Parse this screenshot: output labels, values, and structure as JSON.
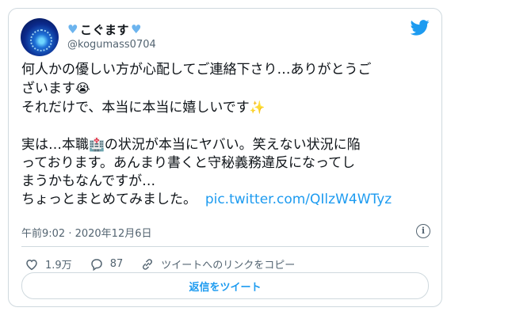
{
  "user": {
    "display_name": "こぐます",
    "handle": "@kogumass0704",
    "name_emoji": "blue-heart"
  },
  "tweet": {
    "line1": "何人かの優しい方が心配してご連絡下さり…ありがとうご",
    "line2_text": "ざいます",
    "line2_emoji": "😭",
    "line3_text": "それだけで、本当に本当に嬉しいです",
    "line3_emoji": "✨",
    "line5_a": "実は…本職",
    "line5_emoji": "🏥",
    "line5_b": "の状況が本当にヤバい。笑えない状況に陥",
    "line6": "っております。あんまり書くと守秘義務違反になってし",
    "line7": "まうかもなんですが…",
    "line8": "ちょっとまとめてみました。",
    "link": "pic.twitter.com/QIlzW4WTyz"
  },
  "meta": {
    "timestamp": "午前9:02 · 2020年12月6日"
  },
  "actions": {
    "likes": "1.9万",
    "replies": "87",
    "copy_link": "ツイートへのリンクをコピー"
  },
  "reply_button": "返信をツイート",
  "colors": {
    "accent": "#1d9bf0",
    "heart": "#6cb4ee",
    "muted": "#536471",
    "border": "#cfd9de"
  }
}
